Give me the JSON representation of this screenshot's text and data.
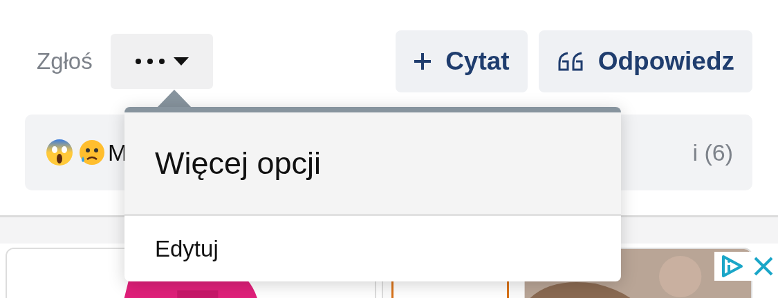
{
  "actions": {
    "report": "Zgłoś",
    "more": {
      "expanded": true
    },
    "buttons": [
      {
        "kind": "plus",
        "label": "Cytat"
      },
      {
        "kind": "quote",
        "label": "Odpowiedz"
      }
    ]
  },
  "reactions": {
    "left": "M",
    "right": "i (6)"
  },
  "menu": {
    "title": "Więcej opcji",
    "items": [
      "Edytuj"
    ]
  },
  "cards": [
    {
      "kind": "picture"
    },
    {
      "kind": "picture",
      "tagged": true
    }
  ]
}
